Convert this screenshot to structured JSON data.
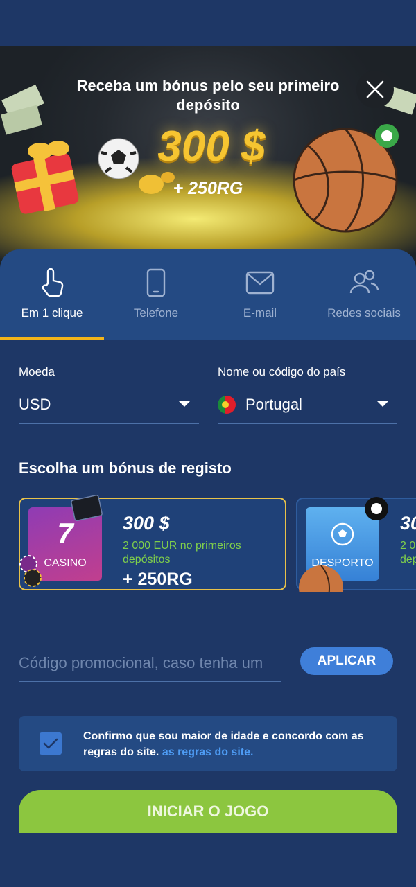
{
  "banner": {
    "title": "Receba um bónus pelo seu primeiro depósito",
    "amount": "300 $",
    "bonus": "+ 250RG",
    "close_icon": "close-icon"
  },
  "tabs": [
    {
      "label": "Em 1 clique",
      "icon": "pointer-hand-icon",
      "active": true
    },
    {
      "label": "Telefone",
      "icon": "phone-icon",
      "active": false
    },
    {
      "label": "E-mail",
      "icon": "envelope-icon",
      "active": false
    },
    {
      "label": "Redes sociais",
      "icon": "people-icon",
      "active": false
    }
  ],
  "form": {
    "currency_label": "Moeda",
    "currency_value": "USD",
    "country_label": "Nome ou código do país",
    "country_value": "Portugal"
  },
  "bonus_section": {
    "title": "Escolha um bónus de registo",
    "cards": [
      {
        "category": "CASINO",
        "amount": "300 $",
        "description": "2 000 EUR no primeiros depósitos",
        "bonus": "+ 250RG",
        "selected": true
      },
      {
        "category": "DESPORTO",
        "amount": "30",
        "description": "2 0 dep",
        "selected": false
      }
    ]
  },
  "promo": {
    "placeholder": "Código promocional, caso tenha um",
    "apply_label": "APLICAR"
  },
  "consent": {
    "text": "Confirmo que sou maior de idade e concordo com as regras do site. ",
    "link": "as regras do site.",
    "checked": true
  },
  "start_label": "INICIAR O JOGO",
  "colors": {
    "background": "#1e3766",
    "tab_bar": "#244a83",
    "accent_yellow": "#f3b51a",
    "button_blue": "#3f7fd9",
    "start_green": "#8cc63f",
    "bonus_green": "#7fcf4b"
  }
}
